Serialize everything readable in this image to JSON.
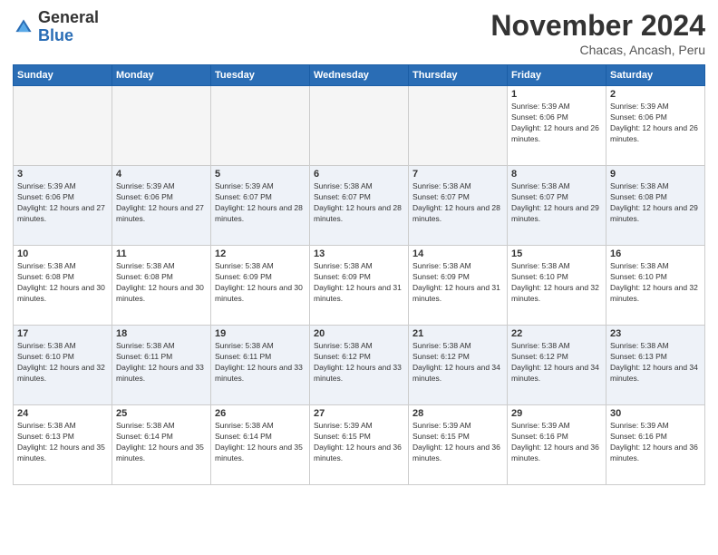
{
  "header": {
    "logo_general": "General",
    "logo_blue": "Blue",
    "month_title": "November 2024",
    "location": "Chacas, Ancash, Peru"
  },
  "days_of_week": [
    "Sunday",
    "Monday",
    "Tuesday",
    "Wednesday",
    "Thursday",
    "Friday",
    "Saturday"
  ],
  "weeks": [
    [
      {
        "day": "",
        "info": "",
        "empty": true
      },
      {
        "day": "",
        "info": "",
        "empty": true
      },
      {
        "day": "",
        "info": "",
        "empty": true
      },
      {
        "day": "",
        "info": "",
        "empty": true
      },
      {
        "day": "",
        "info": "",
        "empty": true
      },
      {
        "day": "1",
        "info": "Sunrise: 5:39 AM\nSunset: 6:06 PM\nDaylight: 12 hours and 26 minutes."
      },
      {
        "day": "2",
        "info": "Sunrise: 5:39 AM\nSunset: 6:06 PM\nDaylight: 12 hours and 26 minutes."
      }
    ],
    [
      {
        "day": "3",
        "info": "Sunrise: 5:39 AM\nSunset: 6:06 PM\nDaylight: 12 hours and 27 minutes."
      },
      {
        "day": "4",
        "info": "Sunrise: 5:39 AM\nSunset: 6:06 PM\nDaylight: 12 hours and 27 minutes."
      },
      {
        "day": "5",
        "info": "Sunrise: 5:39 AM\nSunset: 6:07 PM\nDaylight: 12 hours and 28 minutes."
      },
      {
        "day": "6",
        "info": "Sunrise: 5:38 AM\nSunset: 6:07 PM\nDaylight: 12 hours and 28 minutes."
      },
      {
        "day": "7",
        "info": "Sunrise: 5:38 AM\nSunset: 6:07 PM\nDaylight: 12 hours and 28 minutes."
      },
      {
        "day": "8",
        "info": "Sunrise: 5:38 AM\nSunset: 6:07 PM\nDaylight: 12 hours and 29 minutes."
      },
      {
        "day": "9",
        "info": "Sunrise: 5:38 AM\nSunset: 6:08 PM\nDaylight: 12 hours and 29 minutes."
      }
    ],
    [
      {
        "day": "10",
        "info": "Sunrise: 5:38 AM\nSunset: 6:08 PM\nDaylight: 12 hours and 30 minutes."
      },
      {
        "day": "11",
        "info": "Sunrise: 5:38 AM\nSunset: 6:08 PM\nDaylight: 12 hours and 30 minutes."
      },
      {
        "day": "12",
        "info": "Sunrise: 5:38 AM\nSunset: 6:09 PM\nDaylight: 12 hours and 30 minutes."
      },
      {
        "day": "13",
        "info": "Sunrise: 5:38 AM\nSunset: 6:09 PM\nDaylight: 12 hours and 31 minutes."
      },
      {
        "day": "14",
        "info": "Sunrise: 5:38 AM\nSunset: 6:09 PM\nDaylight: 12 hours and 31 minutes."
      },
      {
        "day": "15",
        "info": "Sunrise: 5:38 AM\nSunset: 6:10 PM\nDaylight: 12 hours and 32 minutes."
      },
      {
        "day": "16",
        "info": "Sunrise: 5:38 AM\nSunset: 6:10 PM\nDaylight: 12 hours and 32 minutes."
      }
    ],
    [
      {
        "day": "17",
        "info": "Sunrise: 5:38 AM\nSunset: 6:10 PM\nDaylight: 12 hours and 32 minutes."
      },
      {
        "day": "18",
        "info": "Sunrise: 5:38 AM\nSunset: 6:11 PM\nDaylight: 12 hours and 33 minutes."
      },
      {
        "day": "19",
        "info": "Sunrise: 5:38 AM\nSunset: 6:11 PM\nDaylight: 12 hours and 33 minutes."
      },
      {
        "day": "20",
        "info": "Sunrise: 5:38 AM\nSunset: 6:12 PM\nDaylight: 12 hours and 33 minutes."
      },
      {
        "day": "21",
        "info": "Sunrise: 5:38 AM\nSunset: 6:12 PM\nDaylight: 12 hours and 34 minutes."
      },
      {
        "day": "22",
        "info": "Sunrise: 5:38 AM\nSunset: 6:12 PM\nDaylight: 12 hours and 34 minutes."
      },
      {
        "day": "23",
        "info": "Sunrise: 5:38 AM\nSunset: 6:13 PM\nDaylight: 12 hours and 34 minutes."
      }
    ],
    [
      {
        "day": "24",
        "info": "Sunrise: 5:38 AM\nSunset: 6:13 PM\nDaylight: 12 hours and 35 minutes."
      },
      {
        "day": "25",
        "info": "Sunrise: 5:38 AM\nSunset: 6:14 PM\nDaylight: 12 hours and 35 minutes."
      },
      {
        "day": "26",
        "info": "Sunrise: 5:38 AM\nSunset: 6:14 PM\nDaylight: 12 hours and 35 minutes."
      },
      {
        "day": "27",
        "info": "Sunrise: 5:39 AM\nSunset: 6:15 PM\nDaylight: 12 hours and 36 minutes."
      },
      {
        "day": "28",
        "info": "Sunrise: 5:39 AM\nSunset: 6:15 PM\nDaylight: 12 hours and 36 minutes."
      },
      {
        "day": "29",
        "info": "Sunrise: 5:39 AM\nSunset: 6:16 PM\nDaylight: 12 hours and 36 minutes."
      },
      {
        "day": "30",
        "info": "Sunrise: 5:39 AM\nSunset: 6:16 PM\nDaylight: 12 hours and 36 minutes."
      }
    ]
  ]
}
